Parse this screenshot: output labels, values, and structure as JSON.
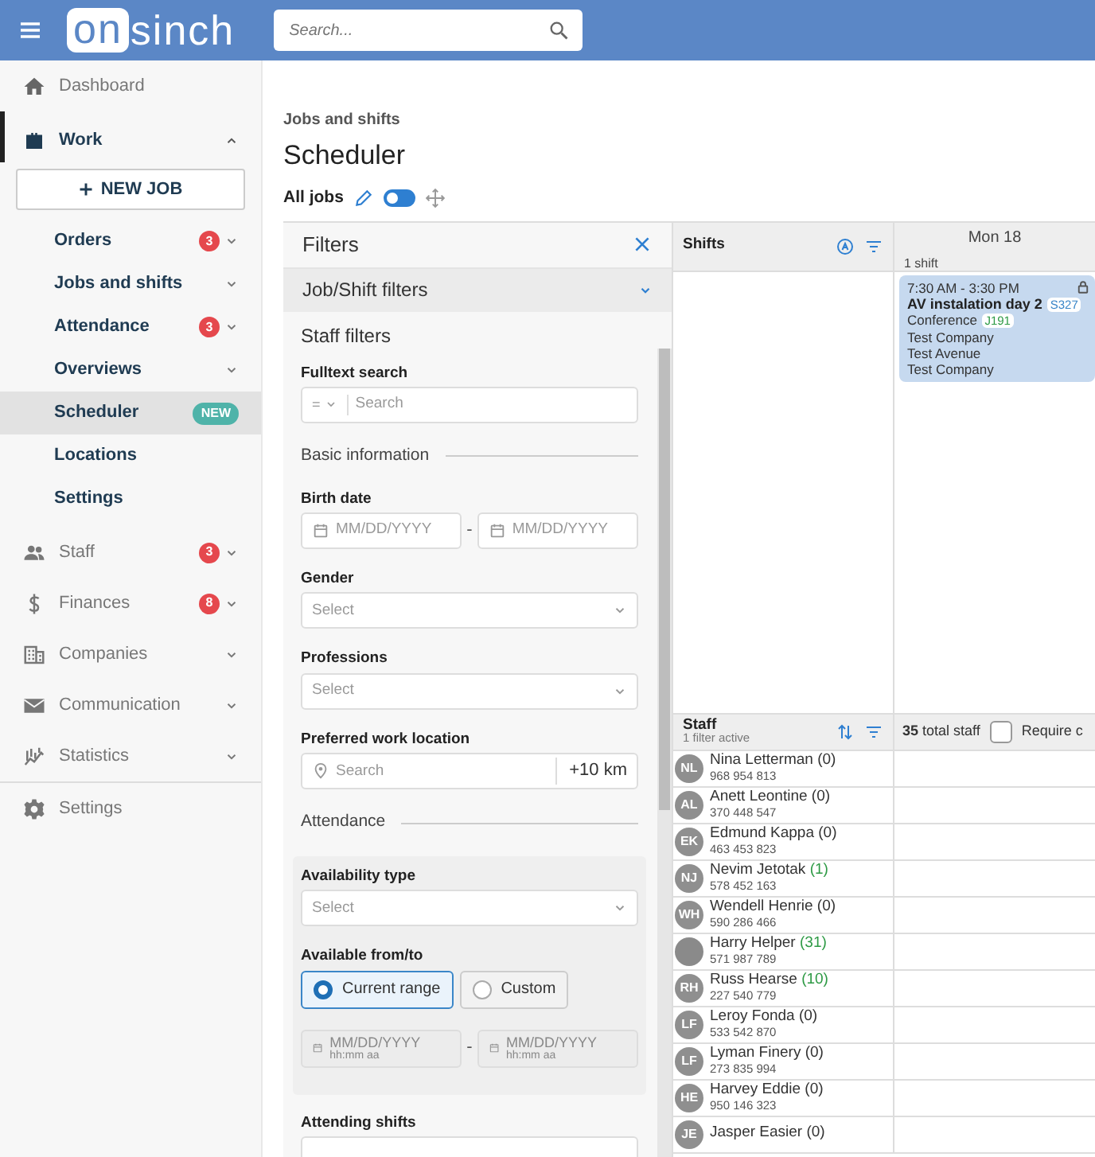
{
  "topbar": {
    "logo": {
      "boxed": "on",
      "rest": "sinch"
    },
    "search_placeholder": "Search..."
  },
  "sidebar": {
    "items": [
      {
        "label": "Dashboard",
        "selected": false
      },
      {
        "label": "Work",
        "selected": true,
        "expanded": true,
        "new_button": "NEW JOB",
        "children": [
          {
            "label": "Orders",
            "selected": false,
            "expanded": false,
            "badge": {
              "kind": "count",
              "text": "3"
            }
          },
          {
            "label": "Jobs and shifts",
            "selected": false,
            "expanded": false
          },
          {
            "label": "Attendance",
            "selected": false,
            "expanded": false,
            "badge": {
              "kind": "count",
              "text": "3"
            }
          },
          {
            "label": "Overviews",
            "selected": false,
            "expanded": false
          },
          {
            "label": "Scheduler",
            "selected": true,
            "badge": {
              "kind": "new",
              "text": "NEW"
            }
          },
          {
            "label": "Locations",
            "selected": false
          },
          {
            "label": "Settings",
            "selected": false
          }
        ]
      },
      {
        "label": "Staff",
        "selected": false,
        "expanded": false,
        "badge": {
          "kind": "count",
          "text": "3"
        }
      },
      {
        "label": "Finances",
        "selected": false,
        "expanded": false,
        "badge": {
          "kind": "count",
          "text": "8"
        }
      },
      {
        "label": "Companies",
        "selected": false,
        "expanded": false
      },
      {
        "label": "Communication",
        "selected": false,
        "expanded": false
      },
      {
        "label": "Statistics",
        "selected": false,
        "expanded": false
      }
    ],
    "footer_item": {
      "label": "Settings",
      "selected": false
    }
  },
  "page": {
    "breadcrumb": "Jobs and shifts",
    "title": "Scheduler",
    "view_label": "All jobs",
    "toggle_on": false
  },
  "filters": {
    "title": "Filters",
    "sections": [
      {
        "label": "Job/Shift filters",
        "expanded": false
      }
    ],
    "staff_title": "Staff filters",
    "fields": [
      {
        "kind": "search",
        "label": "Fulltext search",
        "operator": "=",
        "placeholder": "Search"
      },
      {
        "kind": "heading",
        "label": "Basic information"
      },
      {
        "kind": "daterange",
        "label": "Birth date",
        "separator": "-",
        "inputs": [
          {
            "placeholder": "MM/DD/YYYY"
          },
          {
            "placeholder": "MM/DD/YYYY"
          }
        ]
      },
      {
        "kind": "select",
        "label": "Gender",
        "placeholder": "Select"
      },
      {
        "kind": "select",
        "label": "Professions",
        "placeholder": "Select"
      },
      {
        "kind": "location",
        "label": "Preferred work location",
        "placeholder": "Search",
        "radius": "+10 km"
      },
      {
        "kind": "heading",
        "label": "Attendance"
      },
      {
        "kind": "group",
        "fields": [
          {
            "kind": "select",
            "label": "Availability type",
            "placeholder": "Select"
          },
          {
            "kind": "radios",
            "label": "Available from/to",
            "options": [
              {
                "label": "Current range",
                "selected": true
              },
              {
                "label": "Custom",
                "selected": false
              }
            ]
          },
          {
            "kind": "daterange",
            "separator": "-",
            "disabled": true,
            "inputs": [
              {
                "placeholder": "MM/DD/YYYY",
                "time": "hh:mm aa"
              },
              {
                "placeholder": "MM/DD/YYYY",
                "time": "hh:mm aa"
              }
            ]
          }
        ]
      },
      {
        "kind": "field",
        "label": "Attending shifts"
      }
    ]
  },
  "scheduler": {
    "shifts_title": "Shifts",
    "days": [
      {
        "label": "Mon 18",
        "count": "1 shift"
      }
    ],
    "shift": {
      "time": "7:30 AM - 3:30 PM",
      "title": "AV instalation day 2",
      "code": "S327",
      "type": "Conference",
      "job_code": "J191",
      "lines": [
        "Test Company",
        "Test Avenue",
        "Test Company"
      ],
      "locked": true
    },
    "staff": {
      "title": "Staff",
      "subtitle": "1 filter active",
      "total": "35",
      "total_label": "total staff",
      "require_label": "Require c",
      "require_checked": false,
      "rows": [
        {
          "kind": "initials",
          "initials": "NL",
          "name": "Nina Letterman",
          "count": "(0)",
          "highlighted": false,
          "phone": "968 954 813"
        },
        {
          "kind": "initials",
          "initials": "AL",
          "name": "Anett Leontine",
          "count": "(0)",
          "highlighted": false,
          "phone": "370 448 547"
        },
        {
          "kind": "initials",
          "initials": "EK",
          "name": "Edmund Kappa",
          "count": "(0)",
          "highlighted": false,
          "phone": "463 453 823"
        },
        {
          "kind": "initials",
          "initials": "NJ",
          "name": "Nevim Jetotak",
          "count": "(1)",
          "highlighted": true,
          "phone": "578 452 163"
        },
        {
          "kind": "initials",
          "initials": "WH",
          "name": "Wendell Henrie",
          "count": "(0)",
          "highlighted": false,
          "phone": "590 286 466"
        },
        {
          "kind": "photo",
          "name": "Harry Helper",
          "count": "(31)",
          "highlighted": true,
          "phone": "571 987 789"
        },
        {
          "kind": "initials",
          "initials": "RH",
          "name": "Russ Hearse",
          "count": "(10)",
          "highlighted": true,
          "phone": "227 540 779"
        },
        {
          "kind": "initials",
          "initials": "LF",
          "name": "Leroy Fonda",
          "count": "(0)",
          "highlighted": false,
          "phone": "533 542 870"
        },
        {
          "kind": "initials",
          "initials": "LF",
          "name": "Lyman Finery",
          "count": "(0)",
          "highlighted": false,
          "phone": "273 835 994"
        },
        {
          "kind": "initials",
          "initials": "HE",
          "name": "Harvey Eddie",
          "count": "(0)",
          "highlighted": false,
          "phone": "950 146 323"
        },
        {
          "kind": "initials",
          "initials": "JE",
          "name": "Jasper Easier",
          "count": "(0)",
          "highlighted": false
        }
      ]
    }
  }
}
